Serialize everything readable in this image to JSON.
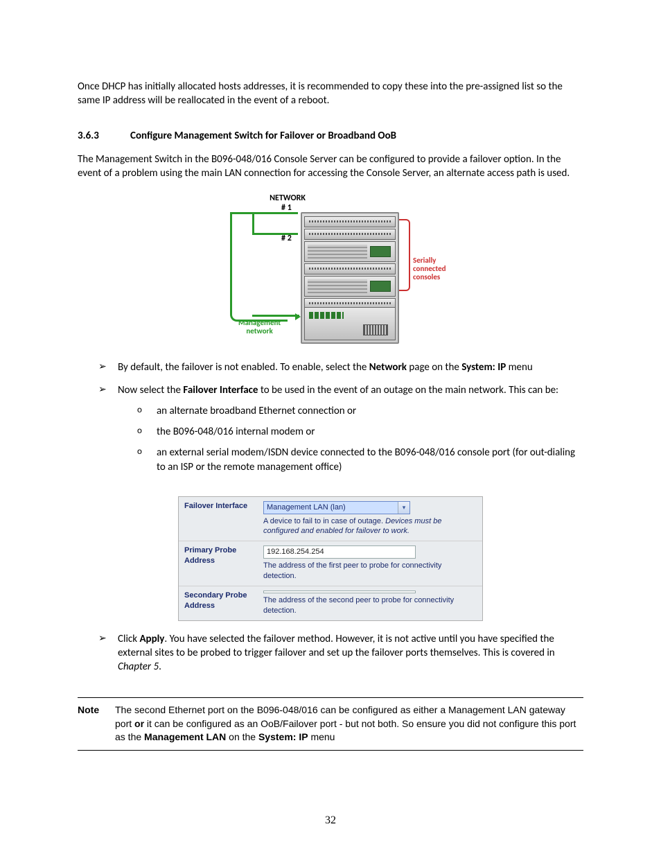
{
  "intro_para": "Once DHCP has initially allocated hosts addresses, it is recommended to copy these into the pre-assigned list so the same IP address will be reallocated in the event of a reboot.",
  "section": {
    "num": "3.6.3",
    "title": "Configure Management Switch for Failover or Broadband OoB"
  },
  "section_para": "The Management Switch in the B096-048/016 Console Server can be configured to provide a failover option. In the event of a problem using the main LAN connection for accessing the Console Server, an alternate access path is used.",
  "diagram": {
    "title": "NETWORK",
    "hash1": "# 1",
    "hash2": "# 2",
    "mn_label_1": "Management",
    "mn_label_2": "network",
    "sc_label_1": "Serially",
    "sc_label_2": "connected",
    "sc_label_3": "consoles"
  },
  "bullets": {
    "b1_pre": "By default, the failover is not enabled. To enable, select the ",
    "b1_bold1": "Network",
    "b1_mid": " page on the ",
    "b1_bold2": "System: IP",
    "b1_post": " menu",
    "b2_pre": "Now select the ",
    "b2_bold": "Failover Interface",
    "b2_post": " to be used in the event of an outage on the main network. This can be:",
    "sub1": "an alternate broadband Ethernet connection or",
    "sub2": "the B096-048/016  internal modem or",
    "sub3": "an external serial modem/ISDN device connected to the B096-048/016 console port (for out-dialing to an ISP or the remote management office)",
    "b3_pre": "Click ",
    "b3_bold": "Apply",
    "b3_post": ". You have selected the failover method. However, it is not active until you have specified the external sites to be probed to trigger failover and set up the failover ports themselves. This is covered in ",
    "b3_ital": "Chapter 5",
    "b3_end": "."
  },
  "form": {
    "r1_label": "Failover Interface",
    "r1_value": "Management LAN (lan)",
    "r1_hint_pre": "A device to fail to in case of outage. ",
    "r1_hint_ital": "Devices must be configured and enabled for failover to work.",
    "r2_label": "Primary Probe Address",
    "r2_value": "192.168.254.254",
    "r2_hint": "The address of the first peer to probe for connectivity detection.",
    "r3_label": "Secondary Probe Address",
    "r3_value": "",
    "r3_hint": "The address of the second peer to probe for connectivity detection."
  },
  "note": {
    "tag": "Note",
    "pre": "The second Ethernet port on the B096-048/016 can be configured as either a Management LAN gateway port ",
    "or": "or",
    "mid": " it can be configured as an OoB/Failover port - but not both. So ensure you did not configure this port as the ",
    "bold2": "Management LAN",
    "mid2": " on the ",
    "bold3": "System: IP",
    "post": " menu"
  },
  "page_number": "32"
}
